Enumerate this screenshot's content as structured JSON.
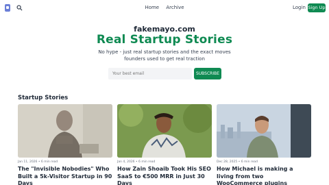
{
  "nav": {
    "links": [
      "Home",
      "Archive"
    ],
    "login": "Login",
    "signup": "Sign Up"
  },
  "hero": {
    "domain": "fakemayo.com",
    "title": "Real Startup Stories",
    "tagline": "No hype - just real startup stories and the exact moves founders used to get real traction",
    "email_placeholder": "Your best email",
    "subscribe": "SUBSCRIBE"
  },
  "section": {
    "title": "Startup Stories"
  },
  "cards": [
    {
      "meta": "Jan 11, 2026 • 6 min read",
      "title": "The \"Invisible Nobodies\" Who Built a 5k-Visitor Startup in 90 Days"
    },
    {
      "meta": "Jan 4, 2026 • 6 min read",
      "title": "How Zain Shoaib Took His SEO SaaS to €500 MRR in Just 30 Days"
    },
    {
      "meta": "Dec 28, 2025 • 6 min read",
      "title": "How Michael is making a living from two WooCommerce plugins"
    }
  ],
  "colors": {
    "accent": "#0f8a52",
    "logo": "#6b7fd7"
  }
}
